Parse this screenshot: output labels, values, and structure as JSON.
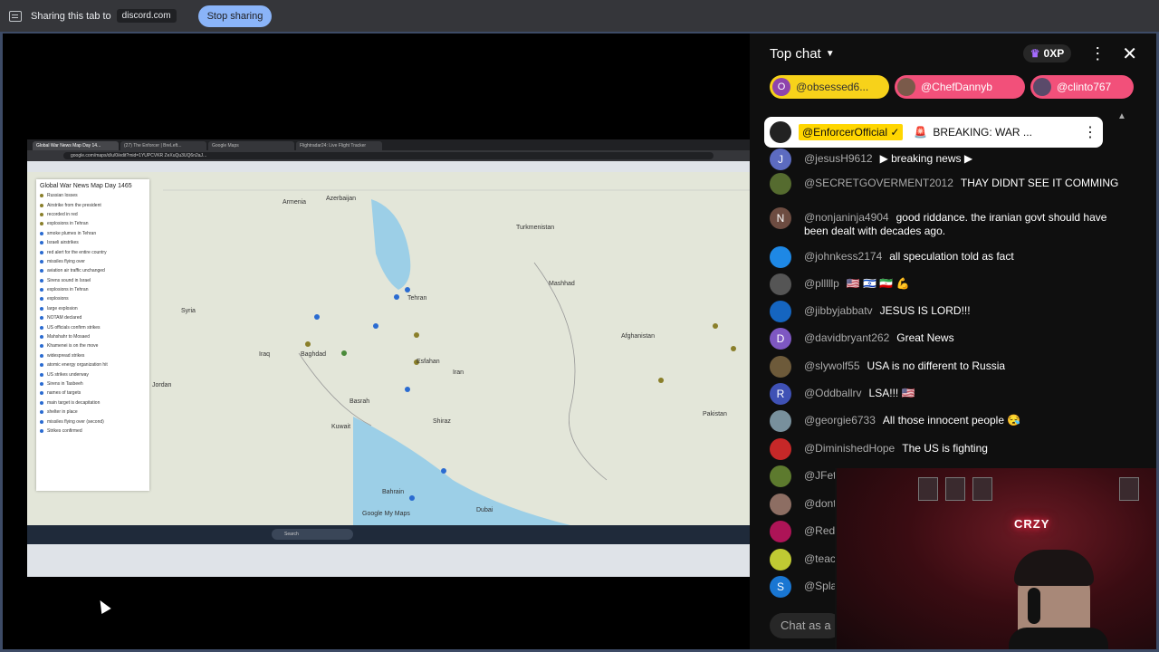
{
  "share_bar": {
    "sharing_text": "Sharing this tab to",
    "domain": "discord.com",
    "stop_label": "Stop sharing"
  },
  "shared_screen": {
    "tabs": [
      "Global War News Map Day 14...",
      "(27) The Enforcer | BreLeft...",
      "Google Maps",
      "Flightradar24: Live Flight Tracker"
    ],
    "url": "google.com/maps/d/u/0/edit?mid=1YUPCVKR ZeXuQu3UQ6n2aJ...",
    "map_panel": {
      "title": "Global War News Map Day 1465",
      "items": [
        "Russian losses",
        "Airstrike from the president",
        "recorded in red",
        "explosions in Tehran",
        "smoke plumes in Tehran",
        "Israeli airstrikes",
        "red alert for the entire country",
        "missiles flying over",
        "aviation air traffic unchanged",
        "Sirens sound in Israel",
        "explosions in Tehran",
        "explosions",
        "large explosion",
        "NOTAM declared",
        "US officials confirm strikes",
        "Mahshahr to Mosaed",
        "Khamenei is on the move",
        "widespread strikes",
        "atomic energy organization hit",
        "US strikes underway",
        "Sirens in Tasbeeh",
        "names of targets",
        "main target is decapitation",
        "shelter in place",
        "missiles flying over (second)",
        "Strikes confirmed"
      ]
    },
    "map_labels": [
      "Azerbaijan",
      "Armenia",
      "Turkmenistan",
      "Syria",
      "Iraq",
      "Iran",
      "Afghanistan",
      "Kuwait",
      "Pakistan",
      "Bahrain",
      "Jordan",
      "Mashhad",
      "Tehran",
      "Esfahan",
      "Baghdad",
      "Basrah",
      "Shiraz",
      "Dubai",
      "Google My Maps"
    ],
    "taskbar_search": "Search"
  },
  "chat": {
    "title": "Top chat",
    "xp": "0XP",
    "ticker": [
      {
        "initial": "O",
        "name": "@obsessed6..."
      },
      {
        "initial": "",
        "name": "@ChefDannyb"
      },
      {
        "initial": "",
        "name": "@clinto767"
      }
    ],
    "pinned": {
      "author": "@EnforcerOfficial ✓",
      "text": "BREAKING: WAR ..."
    },
    "messages": [
      {
        "initial": "J",
        "color": "#5c6bc0",
        "author": "@jesusH9612",
        "text": "▶ breaking news ▶"
      },
      {
        "initial": "",
        "color": "#556b2f",
        "author": "@SECRETGOVERMENT2012",
        "text": "THAY DIDNT SEE IT COMMING"
      },
      {
        "initial": "N",
        "color": "#6d4c41",
        "author": "@nonjaninja4904",
        "text": "good riddance. the iranian govt should have been dealt with decades ago."
      },
      {
        "initial": "",
        "color": "#1e88e5",
        "author": "@johnkess2174",
        "text": "all speculation told as fact"
      },
      {
        "initial": "",
        "color": "#555555",
        "author": "@plllllp",
        "text": "🇺🇸 🇮🇱 🇮🇷 💪"
      },
      {
        "initial": "",
        "color": "#1565c0",
        "author": "@jibbyjabbatv",
        "text": "JESUS IS LORD!!!"
      },
      {
        "initial": "D",
        "color": "#7e57c2",
        "author": "@davidbryant262",
        "text": "Great News"
      },
      {
        "initial": "",
        "color": "#6d5a3a",
        "author": "@slywolf55",
        "text": "USA is no different to Russia"
      },
      {
        "initial": "R",
        "color": "#3f51b5",
        "author": "@Oddballrv",
        "text": "LSA!!! 🇺🇸"
      },
      {
        "initial": "",
        "color": "#78909c",
        "author": "@georgie6733",
        "text": "All those innocent people 😪"
      },
      {
        "initial": "",
        "color": "#c62828",
        "author": "@DiminishedHope",
        "text": "The US is fighting"
      },
      {
        "initial": "",
        "color": "#5d7a2e",
        "author": "@JFet",
        "text": ""
      },
      {
        "initial": "",
        "color": "#8d6e63",
        "author": "@dont",
        "text": ""
      },
      {
        "initial": "",
        "color": "#ad1457",
        "author": "@Red",
        "text": ""
      },
      {
        "initial": "",
        "color": "#c0ca33",
        "author": "@teac",
        "text": ""
      },
      {
        "initial": "S",
        "color": "#1976d2",
        "author": "@Spla",
        "text": ""
      }
    ],
    "input_placeholder": "Chat as a"
  },
  "webcam": {
    "neon_sign": "CRZY"
  }
}
